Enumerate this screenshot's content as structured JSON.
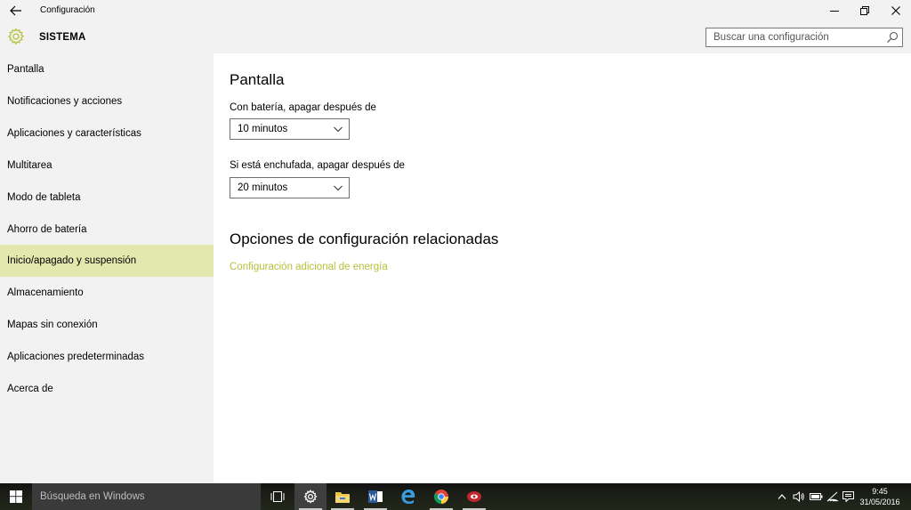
{
  "window": {
    "title": "Configuración",
    "back_icon": "back-arrow-icon",
    "minimize_icon": "minimize-icon",
    "restore_icon": "restore-icon",
    "close_icon": "close-icon"
  },
  "header": {
    "icon": "gear-icon",
    "title": "SISTEMA",
    "search_placeholder": "Buscar una configuración",
    "search_icon": "search-icon"
  },
  "sidebar": {
    "items": [
      {
        "label": "Pantalla",
        "active": false
      },
      {
        "label": "Notificaciones y acciones",
        "active": false
      },
      {
        "label": "Aplicaciones y características",
        "active": false
      },
      {
        "label": "Multitarea",
        "active": false
      },
      {
        "label": "Modo de tableta",
        "active": false
      },
      {
        "label": "Ahorro de batería",
        "active": false
      },
      {
        "label": "Inicio/apagado y suspensión",
        "active": true
      },
      {
        "label": "Almacenamiento",
        "active": false
      },
      {
        "label": "Mapas sin conexión",
        "active": false
      },
      {
        "label": "Aplicaciones predeterminadas",
        "active": false
      },
      {
        "label": "Acerca de",
        "active": false
      }
    ],
    "active_color": "#e3e9ae"
  },
  "main": {
    "section_title": "Pantalla",
    "battery_label": "Con batería, apagar después de",
    "battery_value": "10 minutos",
    "plugged_label": "Si está enchufada, apagar después de",
    "plugged_value": "20 minutos",
    "related_title": "Opciones de configuración relacionadas",
    "related_link": "Configuración adicional de energía",
    "link_color": "#b4c23a"
  },
  "taskbar": {
    "start_icon": "windows-logo-icon",
    "search_text": "Búsqueda en Windows",
    "apps": [
      "task-view-icon",
      "settings-gear-icon",
      "file-explorer-icon",
      "word-icon",
      "edge-icon",
      "chrome-icon",
      "app-icon"
    ],
    "tray_icons": [
      "chevron-up-icon",
      "volume-icon",
      "battery-icon",
      "wifi-icon",
      "notifications-icon"
    ],
    "time": "9:45",
    "date": "31/05/2016"
  }
}
